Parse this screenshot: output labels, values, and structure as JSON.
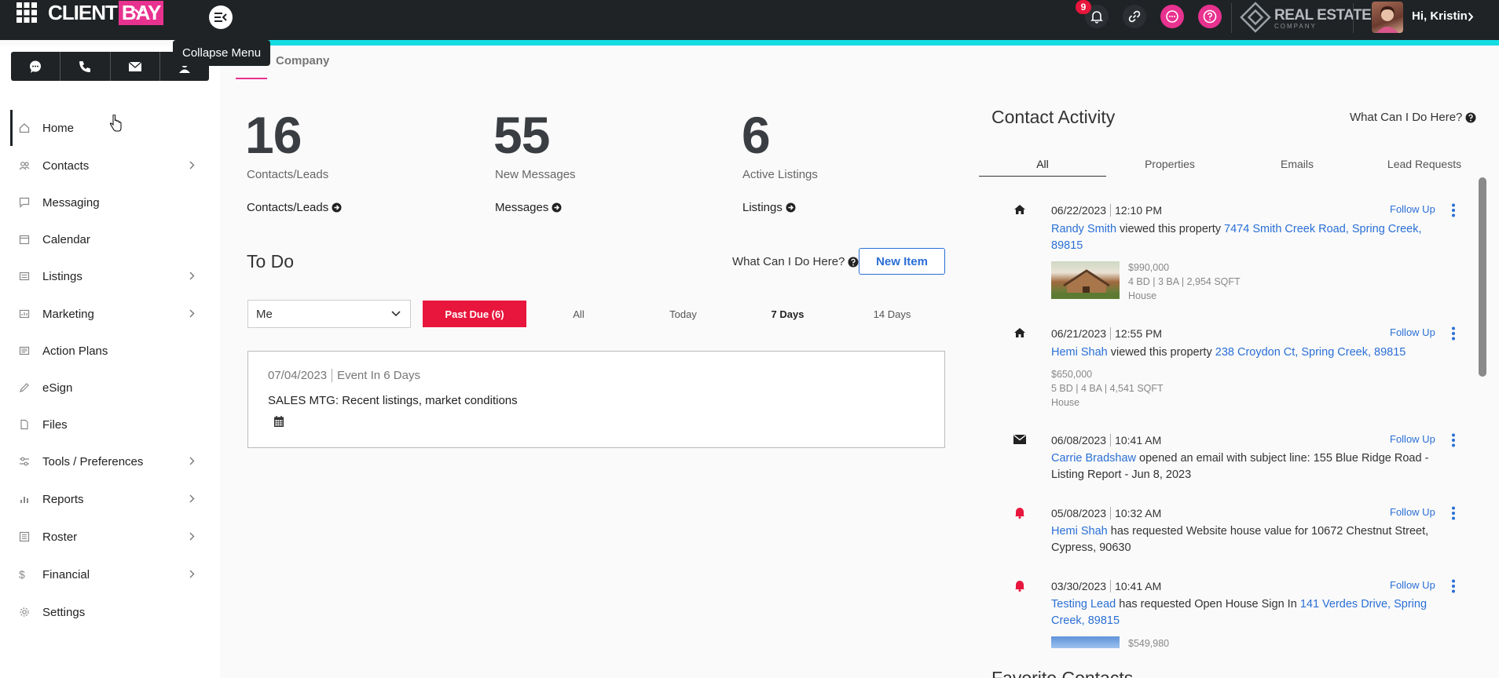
{
  "brand": {
    "client": "CLIENT",
    "bay": "BAY"
  },
  "header": {
    "notification_count": "9",
    "partner_logo_main": "REAL ESTATE",
    "partner_logo_sub": "COMPANY",
    "greeting": "Hi, Kristin"
  },
  "tooltip": "Collapse Menu",
  "breadcrumb_tab": "Company",
  "sidebar": {
    "items": [
      {
        "label": "Home",
        "icon": "home-icon"
      },
      {
        "label": "Contacts",
        "icon": "contacts-icon"
      },
      {
        "label": "Messaging",
        "icon": "message-icon"
      },
      {
        "label": "Calendar",
        "icon": "calendar-icon"
      },
      {
        "label": "Listings",
        "icon": "listings-icon"
      },
      {
        "label": "Marketing",
        "icon": "megaphone-icon"
      },
      {
        "label": "Action Plans",
        "icon": "action-plans-icon"
      },
      {
        "label": "eSign",
        "icon": "pen-icon"
      },
      {
        "label": "Files",
        "icon": "file-icon"
      },
      {
        "label": "Tools / Preferences",
        "icon": "sliders-icon"
      },
      {
        "label": "Reports",
        "icon": "bar-chart-icon"
      },
      {
        "label": "Roster",
        "icon": "roster-icon"
      },
      {
        "label": "Financial",
        "icon": "dollar-icon"
      },
      {
        "label": "Settings",
        "icon": "gear-icon"
      }
    ]
  },
  "stats": [
    {
      "number": "16",
      "label": "Contacts/Leads",
      "link": "Contacts/Leads"
    },
    {
      "number": "55",
      "label": "New Messages",
      "link": "Messages"
    },
    {
      "number": "6",
      "label": "Active Listings",
      "link": "Listings"
    }
  ],
  "todo": {
    "title": "To Do",
    "help": "What Can I Do Here?",
    "new_item": "New Item",
    "assignee": "Me",
    "filters": [
      "Past Due (6)",
      "All",
      "Today",
      "7 Days",
      "14 Days"
    ],
    "task": {
      "date": "07/04/2023",
      "when": "Event In 6 Days",
      "title": "SALES MTG: Recent listings, market conditions"
    }
  },
  "activity": {
    "title": "Contact Activity",
    "help": "What Can I Do Here?",
    "tabs": [
      "All",
      "Properties",
      "Emails",
      "Lead Requests"
    ],
    "follow_up": "Follow Up",
    "items": [
      {
        "date": "06/22/2023",
        "time": "12:10 PM",
        "contact": "Randy Smith",
        "action": " viewed this property ",
        "target": "7474 Smith Creek Road, Spring Creek, 89815",
        "price": "$990,000",
        "specs": "4 BD | 3 BA | 2,954 SQFT",
        "kind": "House"
      },
      {
        "date": "06/21/2023",
        "time": "12:55 PM",
        "contact": "Hemi Shah",
        "action": " viewed this property ",
        "target": "238 Croydon Ct, Spring Creek, 89815",
        "price": "$650,000",
        "specs": "5 BD | 4 BA | 4,541 SQFT",
        "kind": "House"
      },
      {
        "date": "06/08/2023",
        "time": "10:41 AM",
        "contact": "Carrie Bradshaw",
        "action": " opened an email with subject line: 155 Blue Ridge Road - Listing Report - Jun 8, 2023",
        "target": ""
      },
      {
        "date": "05/08/2023",
        "time": "10:32 AM",
        "contact": "Hemi Shah",
        "action": " has requested Website house value for 10672 Chestnut Street, Cypress, 90630",
        "target": ""
      },
      {
        "date": "03/30/2023",
        "time": "10:41 AM",
        "contact": "Testing Lead",
        "action": " has requested Open House Sign In ",
        "target": "141 Verdes Drive, Spring Creek, 89815",
        "price": "$549,980"
      }
    ],
    "next_section": "Favorite Contacts"
  },
  "colors": {
    "accent": "#14dde2",
    "brand_pink": "#e8328f",
    "danger": "#e8163c",
    "link": "#2a6fd6"
  }
}
